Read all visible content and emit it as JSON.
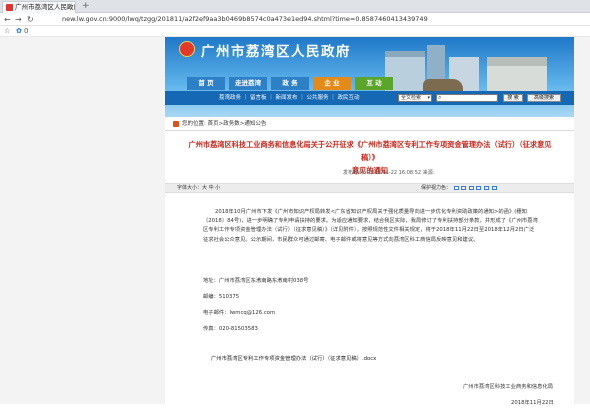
{
  "browser": {
    "tab_title": "广州市荔湾区人民政府",
    "tab_close": "×",
    "new_tab": "+",
    "back": "←",
    "forward": "→",
    "reload": "↻",
    "url": "new.lw.gov.cn:9000/lwq/tzgg/201811/a2f2ef9aa3b0469b8574c0a473e1ed94.shtml?time=0.8587460413439749",
    "fav_star": "☆",
    "fav_item": "0"
  },
  "site": {
    "title": "广州市荔湾区人民政府",
    "nav": [
      "首 页",
      "走进荔湾",
      "政 务",
      "企 业",
      "互 动"
    ],
    "subnav_links": "荔湾政务 ｜ 留言板 ｜ 新闻发布 ｜ 公共服务 ｜ 政民互动",
    "search_scope": "全文检索",
    "search_button": "搜 索",
    "advanced_button": "高级搜索"
  },
  "breadcrumb": "您的位置: 首页>政务数>通知公告",
  "article": {
    "title_line1": "广州市荔湾区科技工业商务和信息化局关于公开征求《广州市荔湾区专利工作专项资金管理办法（试行）（征求意见稿）》",
    "title_line2": "意见的通知",
    "published": "发布时间：2018-11-22 16:08:52 来源：",
    "font_size_label": "字体大小：大 中 小",
    "protect_label": "保护视力色：",
    "paragraph": "2018年10月广州市下发《广州市知识产权局转发<广东省知识产权局关于强化质量导向进一步优化专利资助政策的通知>的函》(穗知〔2018〕84号)，进一步明确了专利申请扶持的要求。为适应通知要求，结合我区实际，我局修订了专利扶持部分条款，并形成了《广州市荔湾区专利工作专项资金管理办法（试行）（征求意见稿）》（详见附件），按照规范性文件相关规定，将于2018年11月22日至2018年12月2日广泛征求社会公众意见。公示期间，市民群众可通过邮寄、电子邮件或将意见等方式向荔湾区科工商信局反映意见和建议。",
    "address": "地址：广州市荔湾区东漖南路东漖南村038号",
    "postcode": "邮编：510375",
    "email": "电子邮件：lwmcq@126.com",
    "fax": "传真：020-81503583",
    "attachment": "广州市荔湾区专利工作专项资金管理办法（试行）（征求意见稿）.docx",
    "signature_org": "广州市荔湾区科技工业商务和信息化局",
    "signature_date": "2018年11月22日"
  },
  "colors": {
    "banner": "#1f78c8",
    "nav_active": "#e48a1a",
    "title_red": "#c8261b"
  }
}
